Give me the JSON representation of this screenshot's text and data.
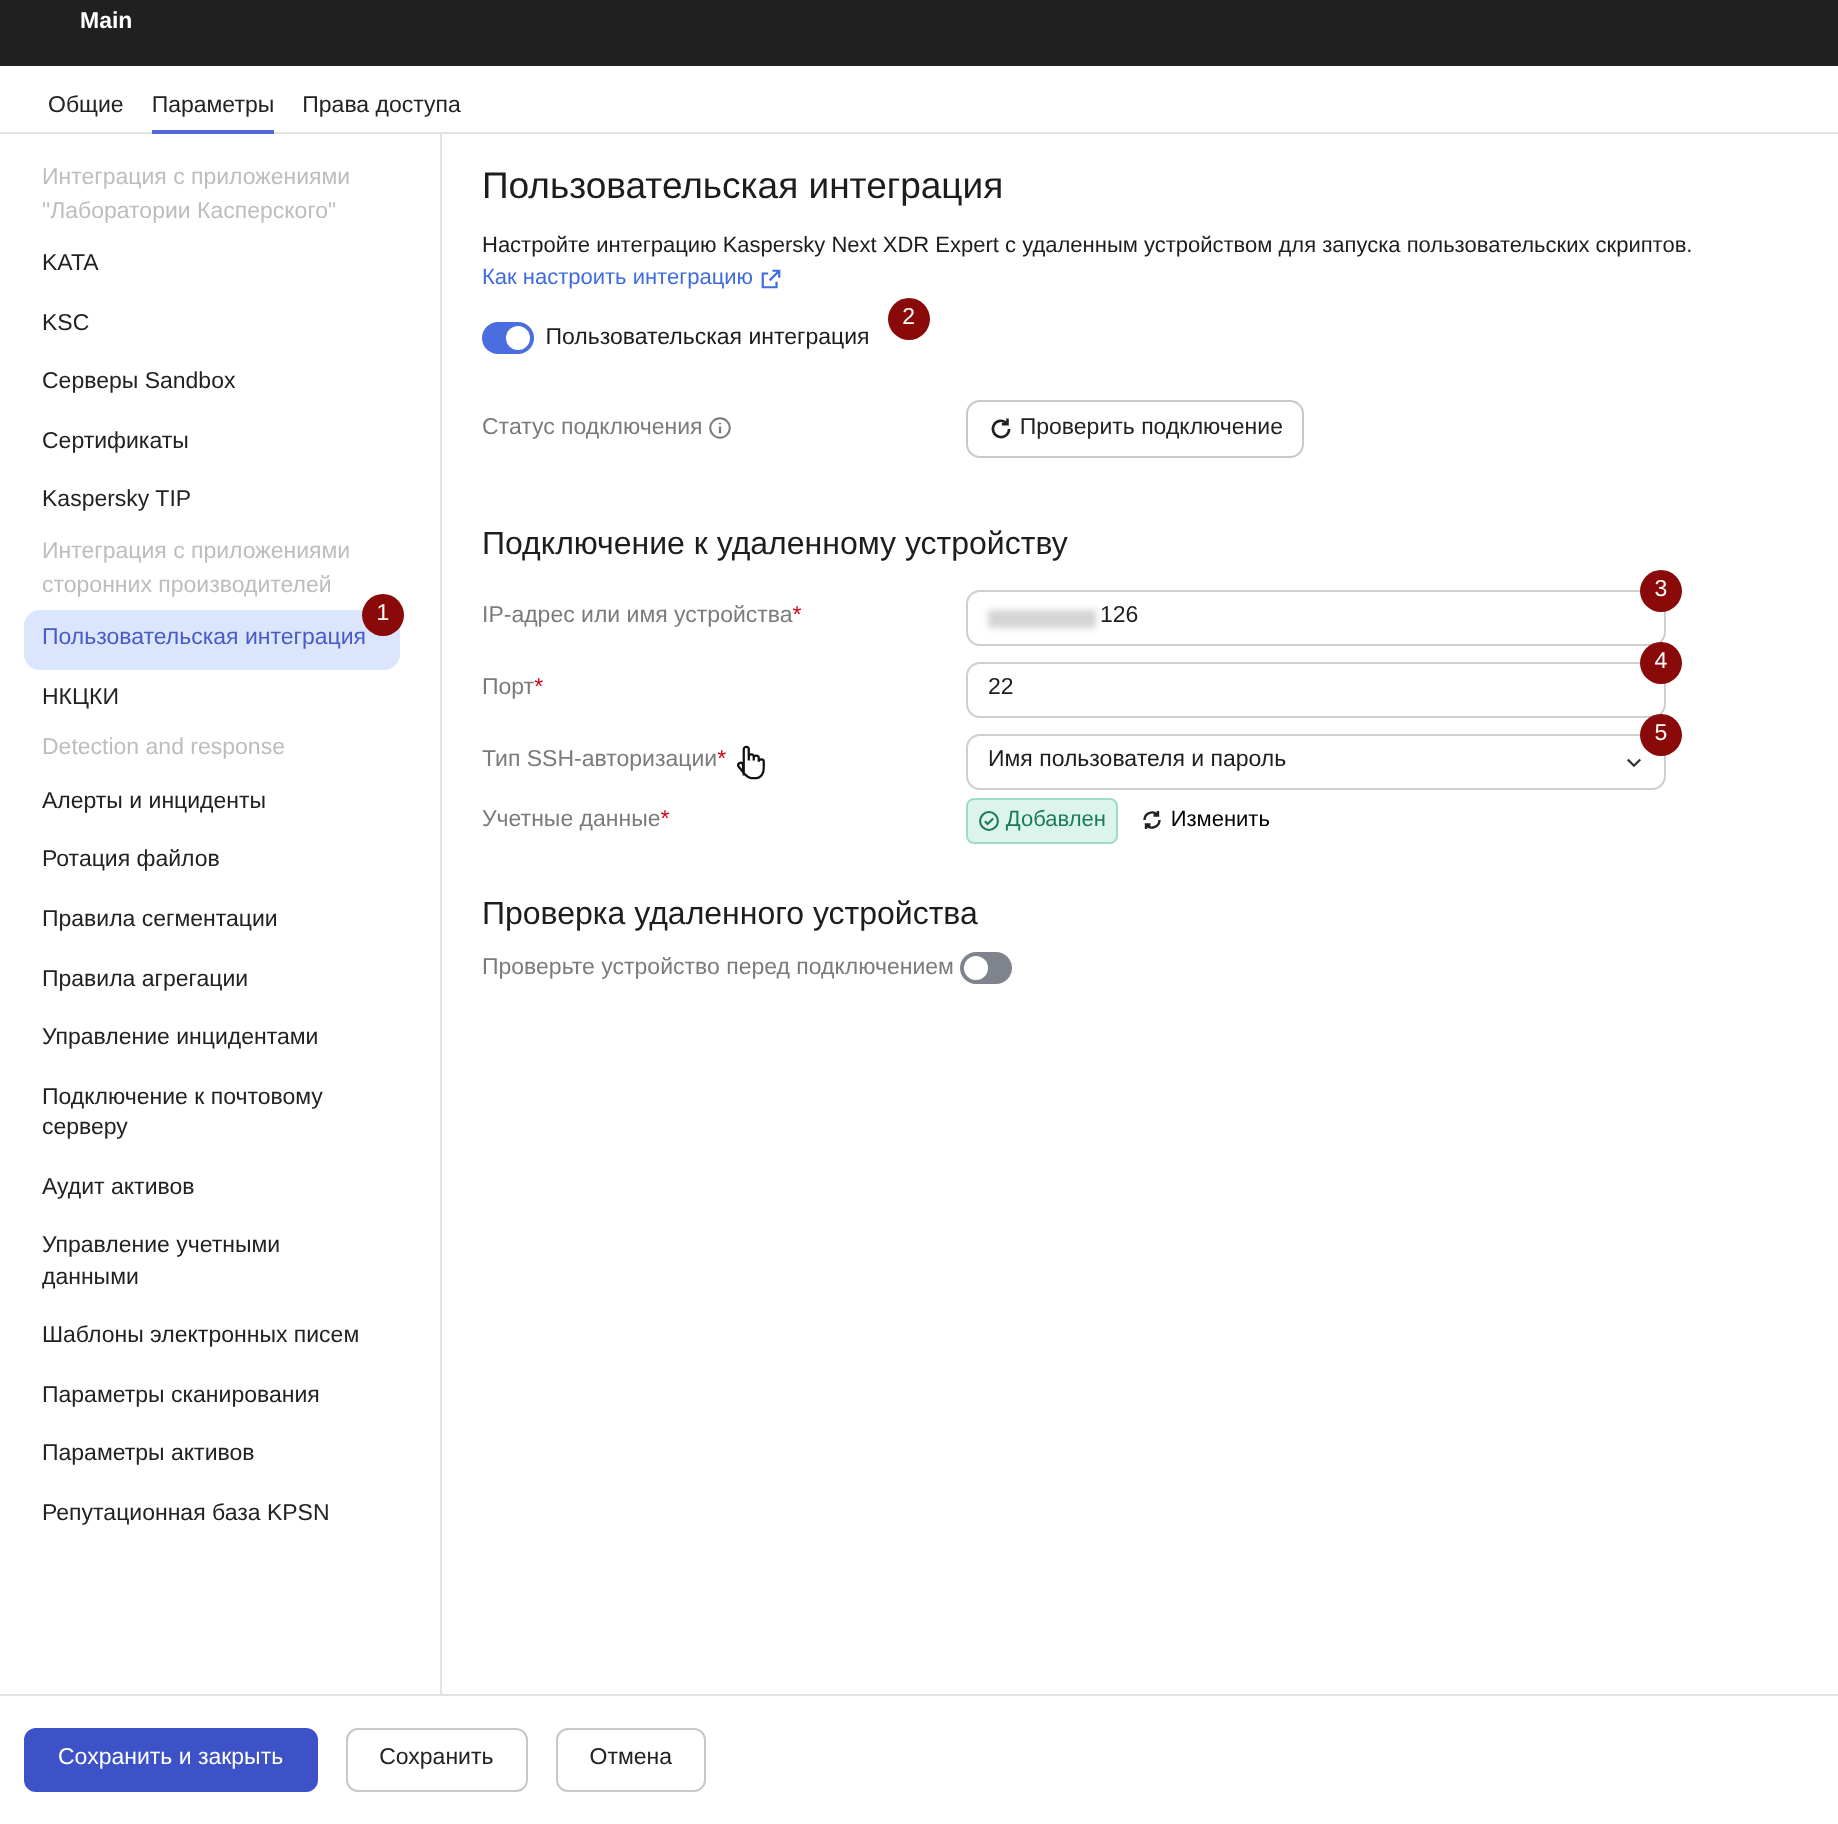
{
  "window": {
    "title": "Main"
  },
  "tabs": [
    {
      "label": "Общие",
      "selected": false
    },
    {
      "label": "Параметры",
      "selected": true
    },
    {
      "label": "Права доступа",
      "selected": false
    }
  ],
  "sidebar": {
    "items": [
      {
        "kind": "group",
        "label": "Интеграция с приложениями \"Лаборатории Касперского\""
      },
      {
        "kind": "item",
        "label": "KATA",
        "selected": false
      },
      {
        "kind": "item",
        "label": "KSC",
        "selected": false
      },
      {
        "kind": "item",
        "label": "Серверы Sandbox",
        "selected": false
      },
      {
        "kind": "item",
        "label": "Сертификаты",
        "selected": false
      },
      {
        "kind": "item",
        "label": "Kaspersky TIP",
        "selected": false
      },
      {
        "kind": "group",
        "label": "Интеграция с приложениями сторонних производителей"
      },
      {
        "kind": "item",
        "label": "Пользовательская интеграция",
        "selected": true,
        "callout": "1"
      },
      {
        "kind": "item",
        "label": "НКЦКИ",
        "selected": false
      },
      {
        "kind": "group",
        "label": "Detection and response"
      },
      {
        "kind": "item",
        "label": "Алерты и инциденты",
        "selected": false
      },
      {
        "kind": "item",
        "label": "Ротация файлов",
        "selected": false
      },
      {
        "kind": "item",
        "label": "Правила сегментации",
        "selected": false
      },
      {
        "kind": "item",
        "label": "Правила агрегации",
        "selected": false
      },
      {
        "kind": "item",
        "label": "Управление инцидентами",
        "selected": false
      },
      {
        "kind": "item",
        "label": "Подключение к почтовому серверу",
        "selected": false
      },
      {
        "kind": "item",
        "label": "Аудит активов",
        "selected": false
      },
      {
        "kind": "item",
        "label": "Управление учетными данными",
        "selected": false
      },
      {
        "kind": "item",
        "label": "Шаблоны электронных писем",
        "selected": false
      },
      {
        "kind": "item",
        "label": "Параметры сканирования",
        "selected": false
      },
      {
        "kind": "item",
        "label": "Параметры активов",
        "selected": false
      },
      {
        "kind": "item",
        "label": "Репутационная база KPSN",
        "selected": false
      }
    ]
  },
  "content": {
    "title": "Пользовательская интеграция",
    "description": "Настройте интеграцию Kaspersky Next XDR Expert с удаленным устройством для запуска пользовательских скриптов.",
    "help_link": "Как настроить интеграцию",
    "integration_toggle": {
      "label": "Пользовательская интеграция",
      "on": true,
      "callout": "2"
    },
    "status": {
      "label": "Статус подключения",
      "button": "Проверить подключение"
    },
    "connection": {
      "title": "Подключение к удаленному устройству",
      "fields": [
        {
          "kind": "input",
          "label": "IP-адрес или имя устройства",
          "required_mark": "*",
          "value": "126",
          "redacted": true,
          "callout": "3"
        },
        {
          "kind": "input",
          "label": "Порт",
          "required_mark": "*",
          "value": "22",
          "redacted": false,
          "callout": "4"
        },
        {
          "kind": "select",
          "label": "Тип SSH-авторизации",
          "required_mark": "*",
          "value": "Имя пользователя и пароль",
          "callout": "5"
        },
        {
          "kind": "credentials",
          "label": "Учетные данные",
          "required_mark": "*",
          "status": "Добавлен",
          "action": "Изменить"
        }
      ]
    },
    "verification": {
      "title": "Проверка удаленного устройства",
      "label": "Проверьте устройство перед подключением",
      "on": false
    }
  },
  "footer": {
    "buttons": [
      {
        "label": "Сохранить и закрыть",
        "kind": "primary"
      },
      {
        "label": "Сохранить",
        "kind": "secondary"
      },
      {
        "label": "Отмена",
        "kind": "secondary"
      }
    ]
  }
}
